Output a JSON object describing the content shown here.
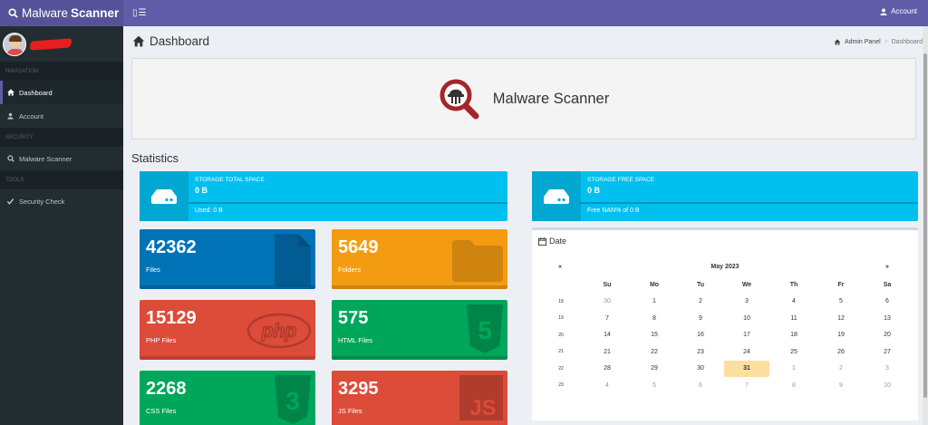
{
  "brand": {
    "name_light": "Malware",
    "name_bold": "Scanner"
  },
  "topbar": {
    "toggle_label": "▯☰",
    "account_label": "Account"
  },
  "sidebar": {
    "sections": [
      {
        "header": "NAVIGATION",
        "items": [
          {
            "label": "Dashboard",
            "icon": "home-icon",
            "active": true
          },
          {
            "label": "Account",
            "icon": "user-icon",
            "active": false
          }
        ]
      },
      {
        "header": "SECURITY",
        "items": [
          {
            "label": "Malware Scanner",
            "icon": "search-icon",
            "active": false
          }
        ]
      },
      {
        "header": "TOOLS",
        "items": [
          {
            "label": "Security Check",
            "icon": "check-icon",
            "active": false
          }
        ]
      }
    ]
  },
  "page": {
    "title": "Dashboard"
  },
  "breadcrumb": {
    "root": "Admin Panel",
    "separator": ">",
    "current": "Dashboard"
  },
  "hero": {
    "title": "Malware Scanner"
  },
  "statistics": {
    "title": "Statistics"
  },
  "storage": {
    "total": {
      "label": "STORAGE TOTAL SPACE",
      "value": "0 B",
      "desc": "Used: 0 B"
    },
    "free": {
      "label": "STORAGE FREE SPACE",
      "value": "0 B",
      "desc": "Free NAN% of 0 B"
    }
  },
  "tiles": [
    {
      "number": "42362",
      "label": "Files",
      "color": "#0073b7",
      "icon": "file-icon"
    },
    {
      "number": "5649",
      "label": "Folders",
      "color": "#f39c12",
      "icon": "folder-icon"
    },
    {
      "number": "15129",
      "label": "PHP Files",
      "color": "#dd4b39",
      "icon": "php-icon"
    },
    {
      "number": "575",
      "label": "HTML Files",
      "color": "#00a65a",
      "icon": "html5-icon"
    },
    {
      "number": "2268",
      "label": "CSS Files",
      "color": "#00a65a",
      "icon": "css3-icon"
    },
    {
      "number": "3295",
      "label": "JS Files",
      "color": "#dd4b39",
      "icon": "js-icon"
    }
  ],
  "calendar": {
    "header": "Date",
    "prev": "«",
    "next": "»",
    "month": "May 2023",
    "weekdays": [
      "Su",
      "Mo",
      "Tu",
      "We",
      "Th",
      "Fr",
      "Sa"
    ],
    "weeks": [
      {
        "wk": "18",
        "days": [
          "30",
          "1",
          "2",
          "3",
          "4",
          "5",
          "6"
        ]
      },
      {
        "wk": "19",
        "days": [
          "7",
          "8",
          "9",
          "10",
          "11",
          "12",
          "13"
        ]
      },
      {
        "wk": "20",
        "days": [
          "14",
          "15",
          "16",
          "17",
          "18",
          "19",
          "20"
        ]
      },
      {
        "wk": "21",
        "days": [
          "21",
          "22",
          "23",
          "24",
          "25",
          "26",
          "27"
        ]
      },
      {
        "wk": "22",
        "days": [
          "28",
          "29",
          "30",
          "31",
          "1",
          "2",
          "3"
        ]
      },
      {
        "wk": "23",
        "days": [
          "4",
          "5",
          "6",
          "7",
          "8",
          "9",
          "10"
        ]
      }
    ],
    "today": "31"
  }
}
